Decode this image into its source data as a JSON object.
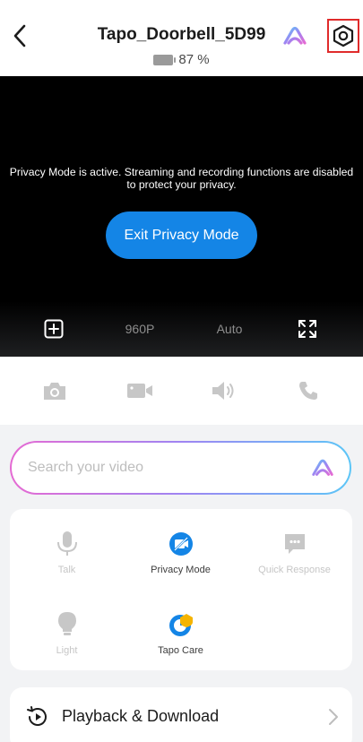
{
  "header": {
    "title": "Tapo_Doorbell_5D99",
    "battery": "87 %"
  },
  "video": {
    "privacy_message": "Privacy Mode is active. Streaming and recording functions are disabled to protect your privacy.",
    "exit_button": "Exit Privacy Mode",
    "resolution": "960P",
    "mode": "Auto"
  },
  "actions": [
    "camera-icon",
    "video-record-icon",
    "speaker-icon",
    "phone-icon"
  ],
  "search": {
    "placeholder": "Search your video"
  },
  "features": [
    {
      "label": "Talk",
      "icon": "microphone-icon",
      "active": false
    },
    {
      "label": "Privacy Mode",
      "icon": "privacy-mode-icon",
      "active": true
    },
    {
      "label": "Quick Response",
      "icon": "quick-response-icon",
      "active": false
    },
    {
      "label": "Light",
      "icon": "light-bulb-icon",
      "active": false
    },
    {
      "label": "Tapo Care",
      "icon": "tapo-care-icon",
      "active": true
    }
  ],
  "playback": {
    "label": "Playback & Download"
  },
  "colors": {
    "accent": "#1485e6",
    "highlight_border": "#e02b2b",
    "gradient_start": "#e56ad3",
    "gradient_end": "#5cc6f7",
    "tapo_care_orange": "#f5b400"
  }
}
